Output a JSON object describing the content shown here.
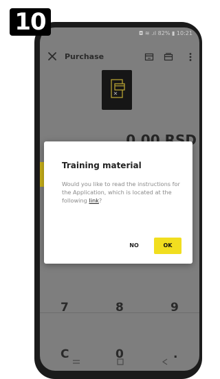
{
  "step_badge": "10",
  "status_bar": {
    "text": "◘ ≋ .ıl 82% ▮ 10:21"
  },
  "app_bar": {
    "title": "Purchase",
    "icons": [
      "close-icon",
      "card-icon",
      "cards-icon",
      "more-vert-icon"
    ]
  },
  "main": {
    "card_icon": "card-reader-icon",
    "amount": "0.00 RSD"
  },
  "dialog": {
    "title": "Training material",
    "body": "Would you like to read the instructions for the Application, which is located at the following",
    "link": "link",
    "body_end": "?",
    "no_label": "NO",
    "ok_label": "OK"
  },
  "keypad": {
    "row3": [
      "7",
      "8",
      "9"
    ],
    "row4": [
      "C",
      "0",
      "."
    ]
  },
  "nav": [
    "back-nav-icon",
    "home-nav-icon",
    "recent-nav-icon"
  ],
  "colors": {
    "accent": "#f1de1f",
    "overlay": "#7e7e7e",
    "badge": "#000000"
  }
}
